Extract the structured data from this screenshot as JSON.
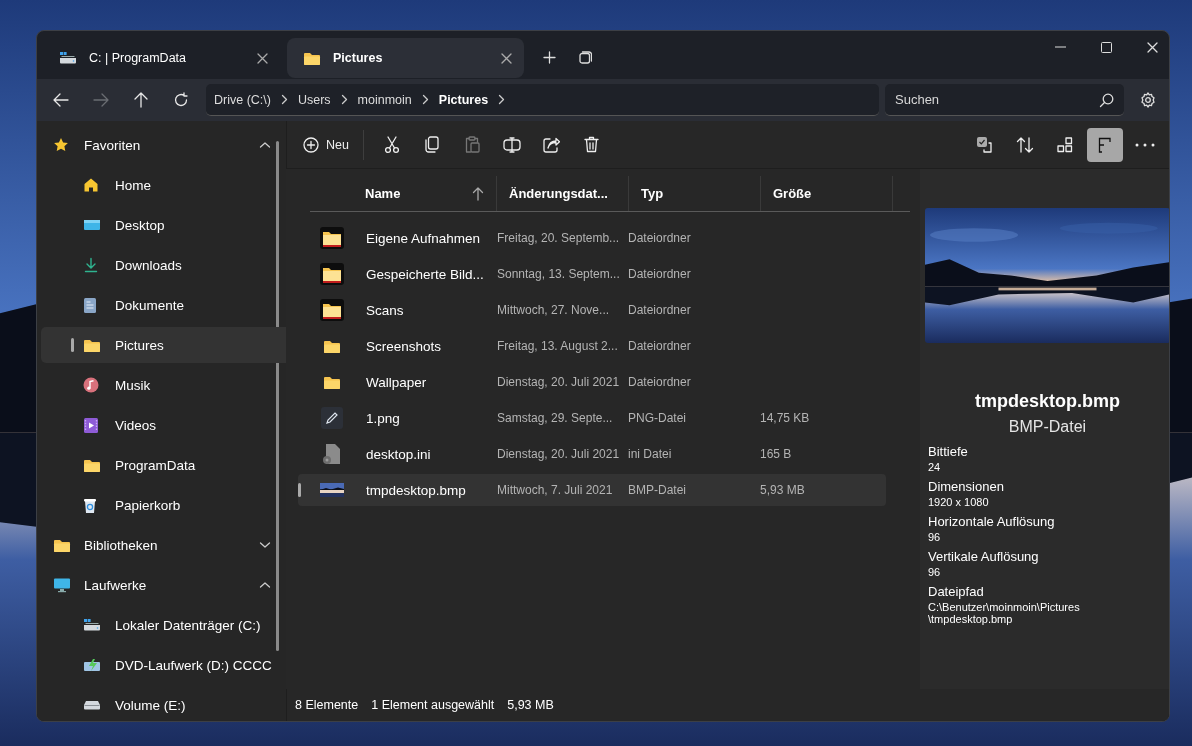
{
  "tabs": [
    {
      "label": "C: | ProgramData",
      "kind": "drive",
      "selected": false
    },
    {
      "label": "Pictures",
      "kind": "folder",
      "selected": true
    }
  ],
  "nav_buttons": [
    {
      "kind": "back",
      "disabled": false
    },
    {
      "kind": "forward",
      "disabled": true
    },
    {
      "kind": "up",
      "disabled": false
    },
    {
      "kind": "refresh",
      "disabled": false
    }
  ],
  "breadcrumbs": [
    {
      "label": "Drive (C:\\)",
      "current": false
    },
    {
      "label": "Users",
      "current": false
    },
    {
      "label": "moinmoin",
      "current": false
    },
    {
      "label": "Pictures",
      "current": true
    }
  ],
  "search": {
    "placeholder": "Suchen"
  },
  "sidebar": {
    "sections": [
      {
        "label": "Favoriten",
        "kind": "star",
        "expanded": true,
        "items": [
          {
            "label": "Home",
            "kind": "home",
            "selected": false
          },
          {
            "label": "Desktop",
            "kind": "desktop",
            "selected": false
          },
          {
            "label": "Downloads",
            "kind": "download",
            "selected": false
          },
          {
            "label": "Dokumente",
            "kind": "document",
            "selected": false
          },
          {
            "label": "Pictures",
            "kind": "folder",
            "selected": true
          },
          {
            "label": "Musik",
            "kind": "music",
            "selected": false
          },
          {
            "label": "Videos",
            "kind": "video",
            "selected": false
          },
          {
            "label": "ProgramData",
            "kind": "folder",
            "selected": false
          },
          {
            "label": "Papierkorb",
            "kind": "recycle",
            "selected": false
          }
        ]
      },
      {
        "label": "Bibliotheken",
        "kind": "folder",
        "expanded": false
      },
      {
        "label": "Laufwerke",
        "kind": "monitor",
        "expanded": true,
        "items": [
          {
            "label": "Lokaler Datenträger (C:)",
            "kind": "drive",
            "selected": false
          },
          {
            "label": "DVD-Laufwerk (D:) CCCC",
            "kind": "dvd",
            "selected": false
          },
          {
            "label": "Volume (E:)",
            "kind": "disk",
            "selected": false
          }
        ]
      }
    ]
  },
  "toolbar": {
    "new_label": "Neu",
    "actions": [
      {
        "kind": "cut",
        "disabled": false
      },
      {
        "kind": "copy",
        "disabled": false
      },
      {
        "kind": "paste",
        "disabled": true
      },
      {
        "kind": "rename",
        "disabled": false
      },
      {
        "kind": "share",
        "disabled": false
      },
      {
        "kind": "delete",
        "disabled": false
      }
    ],
    "view_actions": [
      {
        "kind": "select",
        "selected": false
      },
      {
        "kind": "sort",
        "selected": false
      },
      {
        "kind": "layout",
        "selected": false
      },
      {
        "kind": "preview",
        "selected": true
      },
      {
        "kind": "more",
        "selected": false
      }
    ]
  },
  "table": {
    "columns": [
      {
        "label": "Name",
        "sorted": true
      },
      {
        "label": "Änderungsdat...",
        "sorted": false
      },
      {
        "label": "Typ",
        "sorted": false
      },
      {
        "label": "Größe",
        "sorted": false
      }
    ],
    "rows": [
      {
        "kind": "folder-thumb",
        "name": "Eigene Aufnahmen",
        "modified": "Freitag, 20. Septemb...",
        "type": "Dateiordner",
        "selected": false
      },
      {
        "kind": "folder-thumb",
        "name": "Gespeicherte Bild...",
        "modified": "Sonntag, 13. Septem...",
        "type": "Dateiordner",
        "selected": false
      },
      {
        "kind": "folder-thumb",
        "name": "Scans",
        "modified": "Mittwoch, 27. Nove...",
        "type": "Dateiordner",
        "selected": false
      },
      {
        "kind": "folder",
        "name": "Screenshots",
        "modified": "Freitag, 13. August 2...",
        "type": "Dateiordner",
        "selected": false
      },
      {
        "kind": "folder",
        "name": "Wallpaper",
        "modified": "Dienstag, 20. Juli 2021",
        "type": "Dateiordner",
        "selected": false
      },
      {
        "name": "1.png",
        "modified": "Samstag, 29. Septe...",
        "type": "PNG-Datei",
        "size": "14,75 KB",
        "selected": false
      },
      {
        "kind": "settings",
        "name": "desktop.ini",
        "modified": "Dienstag, 20. Juli 2021",
        "type": "ini Datei",
        "size": "165 B",
        "selected": false
      },
      {
        "kind": "bitmap",
        "name": "tmpdesktop.bmp",
        "modified": "Mittwoch, 7. Juli 2021",
        "type": "BMP-Datei",
        "size": "5,93 MB",
        "selected": true
      }
    ]
  },
  "preview": {
    "title": "tmpdesktop.bmp",
    "subtitle": "BMP-Datei",
    "properties": [
      {
        "label": "Bittiefe",
        "value": "24"
      },
      {
        "label": "Dimensionen",
        "value": "1920 x 1080"
      },
      {
        "label": "Horizontale Auflösung",
        "value": "96"
      },
      {
        "label": "Vertikale Auflösung",
        "value": "96"
      },
      {
        "label": "Dateipfad",
        "value": "C:\\Benutzer\\moinmoin\\Pictures\\tmpdesktop.bmp"
      }
    ]
  },
  "status_bar": {
    "count": "8 Elemente",
    "selection": "1 Element ausgewählt",
    "size": "5,93 MB"
  }
}
